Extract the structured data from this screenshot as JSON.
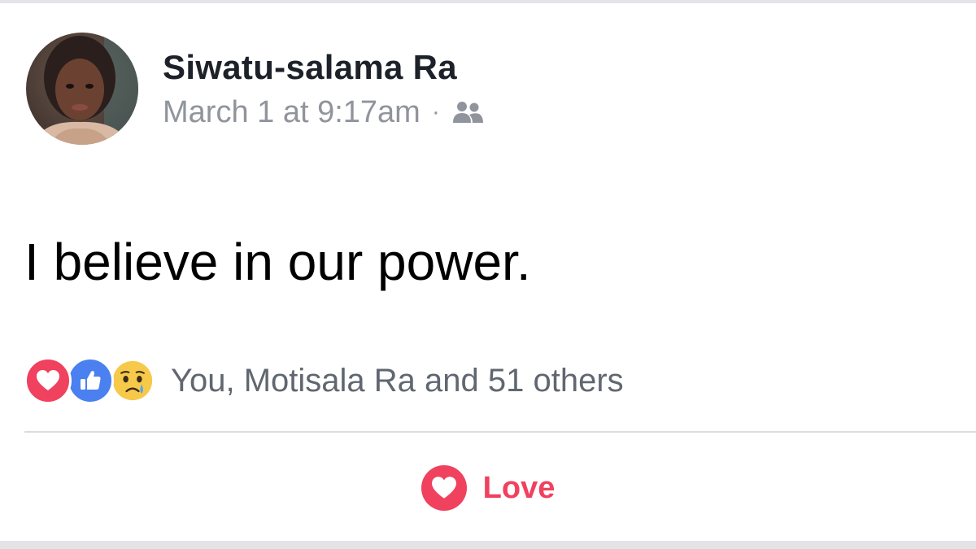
{
  "post": {
    "author_name": "Siwatu-salama Ra",
    "timestamp": "March 1 at 9:17am",
    "meta_separator": "·",
    "audience_icon": "friends-icon",
    "text": "I believe in our power.",
    "avatar_icon": "profile-photo"
  },
  "reactions": {
    "types": [
      "love",
      "like",
      "sad"
    ],
    "summary": "You, Motisala Ra and 51 others",
    "colors": {
      "love": "#f0415e",
      "like": "#4a80f0",
      "sad": "#f7c94a"
    }
  },
  "actions": {
    "love_label": "Love",
    "love_icon": "heart-icon"
  },
  "colors": {
    "name": "#1d2129",
    "meta": "#90949c",
    "reactors": "#606770",
    "divider": "#dadde1"
  }
}
